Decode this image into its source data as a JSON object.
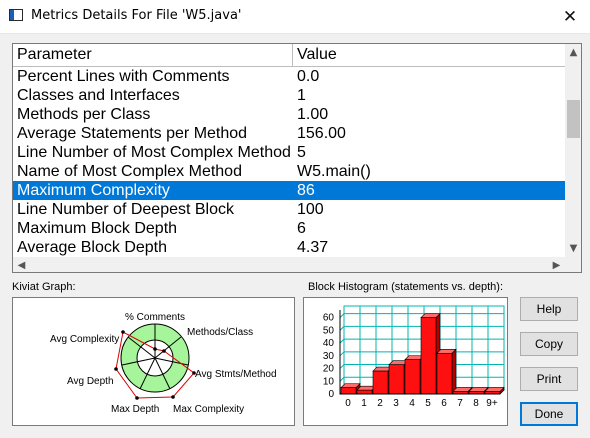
{
  "window": {
    "title": "Metrics Details For File 'W5.java'",
    "close_glyph": "✕"
  },
  "table": {
    "headers": {
      "parameter": "Parameter",
      "value": "Value"
    },
    "rows": [
      {
        "parameter": "Percent Lines with Comments",
        "value": "0.0"
      },
      {
        "parameter": "Classes and Interfaces",
        "value": "1"
      },
      {
        "parameter": "Methods per Class",
        "value": "1.00"
      },
      {
        "parameter": "Average Statements per Method",
        "value": "156.00"
      },
      {
        "parameter": "Line Number of Most Complex Method",
        "value": "5"
      },
      {
        "parameter": "Name of Most Complex Method",
        "value": "W5.main()"
      },
      {
        "parameter": "Maximum Complexity",
        "value": "86",
        "selected": true
      },
      {
        "parameter": "Line Number of Deepest Block",
        "value": "100"
      },
      {
        "parameter": "Maximum Block Depth",
        "value": "6"
      },
      {
        "parameter": "Average Block Depth",
        "value": "4.37"
      }
    ],
    "selected_color": "#0078d7"
  },
  "kiviat": {
    "title": "Kiviat Graph:",
    "axes": [
      "% Comments",
      "Methods/Class",
      "Avg Stmts/Method",
      "Max Complexity",
      "Max Depth",
      "Avg Depth",
      "Avg Complexity"
    ],
    "band_color": "#a6f59a",
    "line_color": "#e00000"
  },
  "histogram": {
    "title": "Block Histogram (statements vs. depth):",
    "bar_color": "#ff1010",
    "grid_color": "#00b4b4"
  },
  "buttons": {
    "help": "Help",
    "copy": "Copy",
    "print": "Print",
    "done": "Done"
  },
  "chart_data": {
    "type": "bar",
    "categories": [
      "0",
      "1",
      "2",
      "3",
      "4",
      "5",
      "6",
      "7",
      "8",
      "9+"
    ],
    "values": [
      5,
      3,
      18,
      23,
      27,
      60,
      32,
      2,
      2,
      2
    ],
    "yticks": [
      "0",
      "10",
      "20",
      "30",
      "40",
      "50",
      "60"
    ],
    "ylim": [
      0,
      66
    ]
  }
}
